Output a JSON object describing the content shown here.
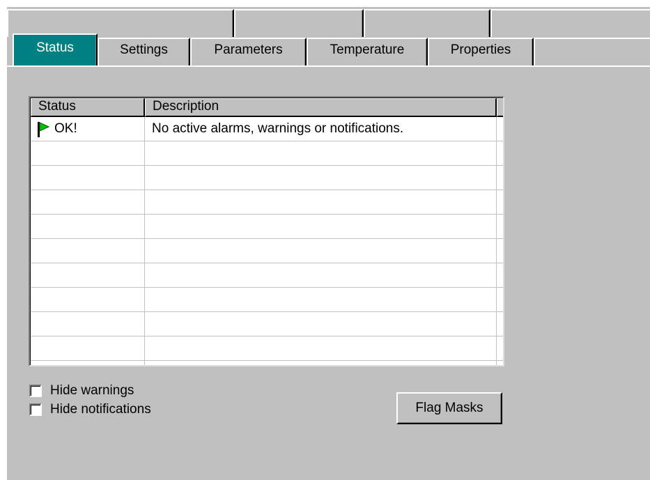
{
  "tabs": [
    {
      "label": "Status",
      "active": true
    },
    {
      "label": "Settings",
      "active": false
    },
    {
      "label": "Parameters",
      "active": false
    },
    {
      "label": "Temperature",
      "active": false
    },
    {
      "label": "Properties",
      "active": false
    }
  ],
  "status_list": {
    "columns": [
      "Status",
      "Description"
    ],
    "rows": [
      {
        "status": "OK!",
        "description": "No active alarms, warnings or notifications.",
        "icon": "green-flag-icon"
      }
    ]
  },
  "options": {
    "hide_warnings": {
      "label": "Hide warnings",
      "checked": false
    },
    "hide_notifications": {
      "label": "Hide notifications",
      "checked": false
    }
  },
  "buttons": {
    "flag_masks": "Flag Masks"
  },
  "colors": {
    "active_tab": "#008080",
    "background": "#c0c0c0",
    "flag": "#00c000"
  }
}
